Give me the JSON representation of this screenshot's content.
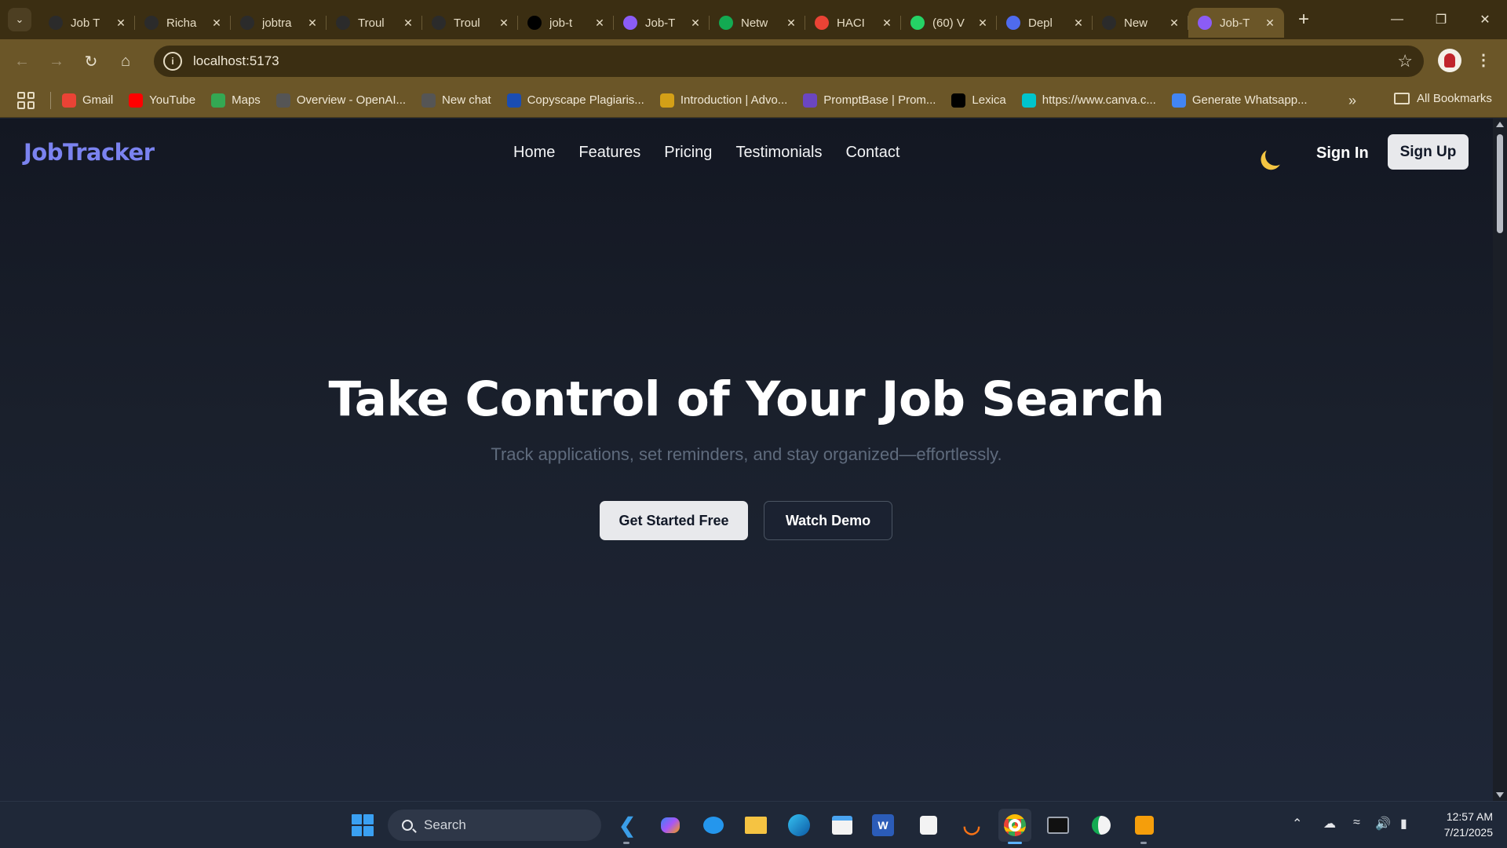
{
  "browser": {
    "tabs": [
      {
        "label": "Job T",
        "icon": "openai-icon",
        "color": "#2b2b2b"
      },
      {
        "label": "Richa",
        "icon": "github-icon",
        "color": "#2b2b2b"
      },
      {
        "label": "jobtra",
        "icon": "render-icon",
        "color": "#2b2b2b"
      },
      {
        "label": "Troul",
        "icon": "render-icon",
        "color": "#2b2b2b"
      },
      {
        "label": "Troul",
        "icon": "render-icon",
        "color": "#2b2b2b"
      },
      {
        "label": "job-t",
        "icon": "vercel-icon",
        "color": "#000000"
      },
      {
        "label": "Job-T",
        "icon": "vite-icon",
        "color": "#8b5cf6"
      },
      {
        "label": "Netw",
        "icon": "mongodb-icon",
        "color": "#13aa52"
      },
      {
        "label": "HACI",
        "icon": "gmail-icon",
        "color": "#ea4335"
      },
      {
        "label": "(60) V",
        "icon": "whatsapp-icon",
        "color": "#25d366"
      },
      {
        "label": "Depl",
        "icon": "deploy-icon",
        "color": "#4f6bed"
      },
      {
        "label": "New",
        "icon": "openai-icon",
        "color": "#2b2b2b"
      },
      {
        "label": "Job-T",
        "icon": "vite-icon",
        "color": "#8b5cf6",
        "active": true
      }
    ],
    "url": "localhost:5173",
    "bookmarks": [
      {
        "label": "Gmail",
        "icon": "gmail-icon",
        "color": "#ea4335"
      },
      {
        "label": "YouTube",
        "icon": "youtube-icon",
        "color": "#ff0000"
      },
      {
        "label": "Maps",
        "icon": "maps-icon",
        "color": "#34a853"
      },
      {
        "label": "Overview - OpenAI...",
        "icon": "openai-icon",
        "color": "#555555"
      },
      {
        "label": "New chat",
        "icon": "openai-icon",
        "color": "#555555"
      },
      {
        "label": "Copyscape Plagiaris...",
        "icon": "copyscape-icon",
        "color": "#1a4db3"
      },
      {
        "label": "Introduction | Advo...",
        "icon": "advo-icon",
        "color": "#d4a017"
      },
      {
        "label": "PromptBase | Prom...",
        "icon": "promptbase-icon",
        "color": "#6b46c1"
      },
      {
        "label": "Lexica",
        "icon": "lexica-icon",
        "color": "#000000"
      },
      {
        "label": "https://www.canva.c...",
        "icon": "canva-icon",
        "color": "#00c4cc"
      },
      {
        "label": "Generate Whatsapp...",
        "icon": "document-icon",
        "color": "#4285f4"
      }
    ],
    "all_bookmarks": "All Bookmarks"
  },
  "site": {
    "logo": "JobTracker",
    "nav": [
      "Home",
      "Features",
      "Pricing",
      "Testimonials",
      "Contact"
    ],
    "sign_in": "Sign In",
    "sign_up": "Sign Up",
    "theme_toggle_icon": "moon-icon",
    "hero": {
      "title": "Take Control of Your Job Search",
      "subtitle": "Track applications, set reminders, and stay organized—effortlessly.",
      "primary_cta": "Get Started Free",
      "secondary_cta": "Watch Demo"
    }
  },
  "taskbar": {
    "search_placeholder": "Search",
    "time": "12:57 AM",
    "date": "7/21/2025"
  }
}
